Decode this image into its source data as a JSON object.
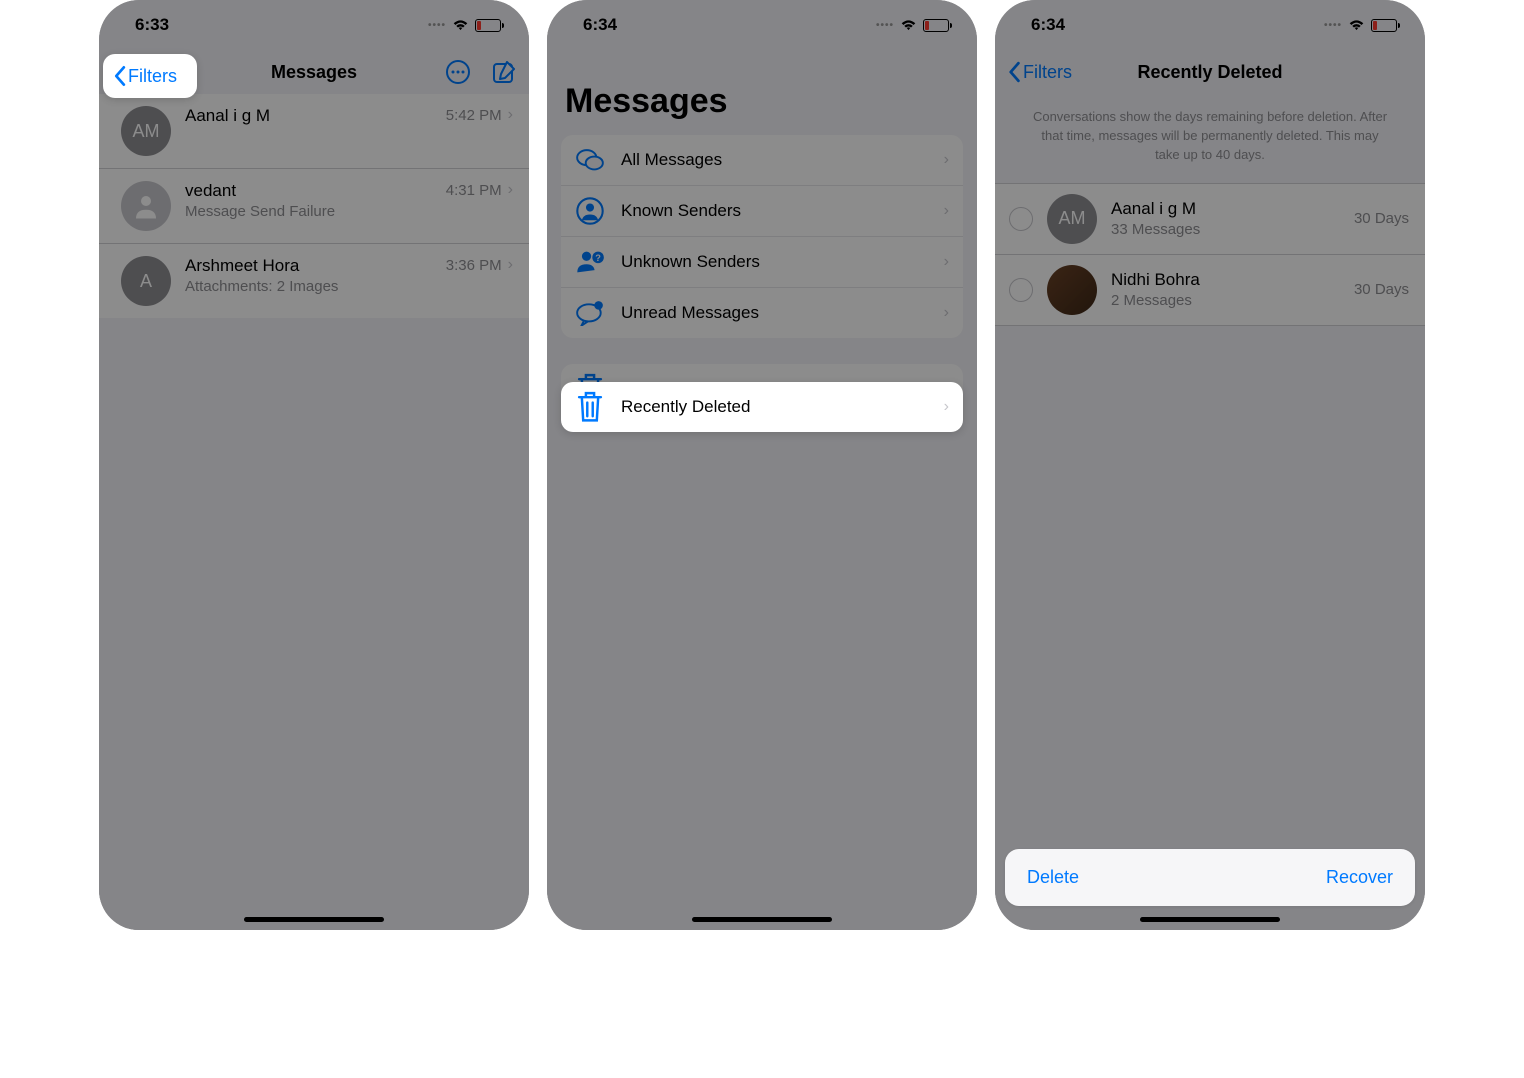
{
  "colors": {
    "accent": "#007aff",
    "battery_low": "#ff3b30"
  },
  "panel1": {
    "status_time": "6:33",
    "back_label": "Filters",
    "title": "Messages",
    "conversations": [
      {
        "name": "Aanal i g M",
        "subtitle": "",
        "time": "5:42 PM",
        "avatar_text": "AM"
      },
      {
        "name": "vedant",
        "subtitle": "Message Send Failure",
        "time": "4:31 PM",
        "avatar_text": ""
      },
      {
        "name": "Arshmeet Hora",
        "subtitle": "Attachments: 2 Images",
        "time": "3:36 PM",
        "avatar_text": "A"
      }
    ]
  },
  "panel2": {
    "status_time": "6:34",
    "title": "Messages",
    "filters": [
      {
        "label": "All Messages",
        "icon": "chat-bubbles"
      },
      {
        "label": "Known Senders",
        "icon": "person-circle"
      },
      {
        "label": "Unknown Senders",
        "icon": "person-question"
      },
      {
        "label": "Unread Messages",
        "icon": "chat-badge"
      }
    ],
    "recently_deleted_label": "Recently Deleted"
  },
  "panel3": {
    "status_time": "6:34",
    "back_label": "Filters",
    "title": "Recently Deleted",
    "info_text": "Conversations show the days remaining before deletion. After that time, messages will be permanently deleted. This may take up to 40 days.",
    "items": [
      {
        "name": "Aanal i g M",
        "subtitle": "33 Messages",
        "days": "30 Days",
        "avatar_text": "AM",
        "photo": false
      },
      {
        "name": "Nidhi Bohra",
        "subtitle": "2 Messages",
        "days": "30 Days",
        "avatar_text": "",
        "photo": true
      }
    ],
    "delete_label": "Delete",
    "recover_label": "Recover"
  }
}
